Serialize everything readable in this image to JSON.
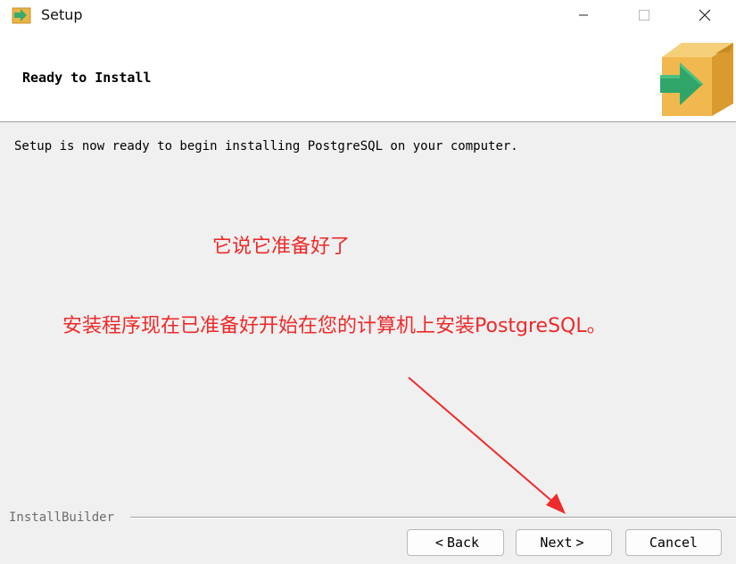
{
  "window": {
    "title": "Setup",
    "icon": "package-arrow-icon",
    "controls": {
      "minimize": "—",
      "maximize": "☐",
      "close": "✕"
    }
  },
  "header": {
    "title": "Ready to Install",
    "logo": "box-arrow-icon"
  },
  "body": {
    "message": "Setup is now ready to begin installing PostgreSQL on your computer."
  },
  "annotations": {
    "note1": "它说它准备好了",
    "note2": "安装程序现在已准备好开始在您的计算机上安装PostgreSQL。",
    "color": "#ee2a2a"
  },
  "footer": {
    "builder_label": "InstallBuilder",
    "back_label": "Back",
    "back_chevron": "<",
    "next_label": "Next",
    "next_chevron": ">",
    "cancel_label": "Cancel"
  }
}
